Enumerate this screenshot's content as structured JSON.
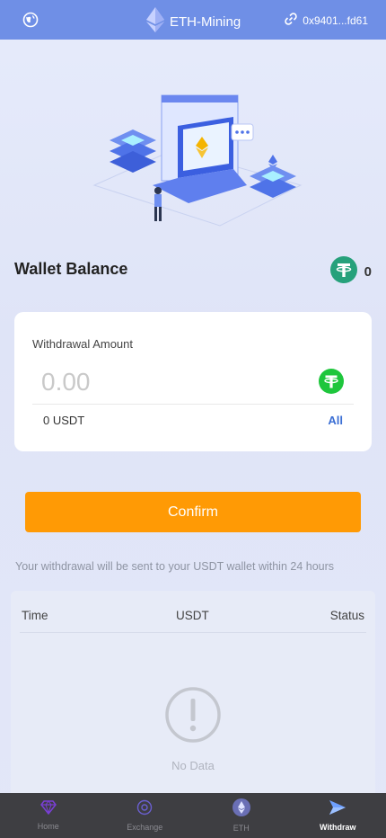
{
  "header": {
    "brand_title": "ETH-Mining",
    "wallet_address": "0x9401...fd61",
    "icons": {
      "left": "globe-icon",
      "brand": "ethereum-logo",
      "wallet": "link-icon"
    }
  },
  "hero": {
    "image": "ethereum-laptop-illustration"
  },
  "balance": {
    "label": "Wallet Balance",
    "value": "0",
    "icon": "tether-usdt-icon"
  },
  "withdraw_card": {
    "label": "Withdrawal Amount",
    "amount_placeholder": "0.00",
    "amount_value": "",
    "available": "0 USDT",
    "all_label": "All"
  },
  "confirm": {
    "label": "Confirm"
  },
  "notice": "Your withdrawal will be sent to your USDT wallet within 24 hours",
  "history": {
    "columns": [
      "Time",
      "USDT",
      "Status"
    ],
    "rows": [],
    "empty_text": "No Data",
    "empty_icon": "exclamation-circle-icon"
  },
  "bottom_nav": [
    {
      "label": "Home",
      "icon": "gem-icon",
      "active": false
    },
    {
      "label": "Exchange",
      "icon": "exchange-icon",
      "active": false
    },
    {
      "label": "ETH",
      "icon": "ethereum-icon",
      "active": false
    },
    {
      "label": "Withdraw",
      "icon": "send-arrow-icon",
      "active": true
    }
  ],
  "colors": {
    "header_bg": "#6f8fe6",
    "confirm_bg": "#ff9a05",
    "usdt_green": "#26a17b",
    "usdt_bright_green": "#1ec63c",
    "link_blue": "#3b6fd4",
    "nav_bg": "#3e3e42"
  }
}
